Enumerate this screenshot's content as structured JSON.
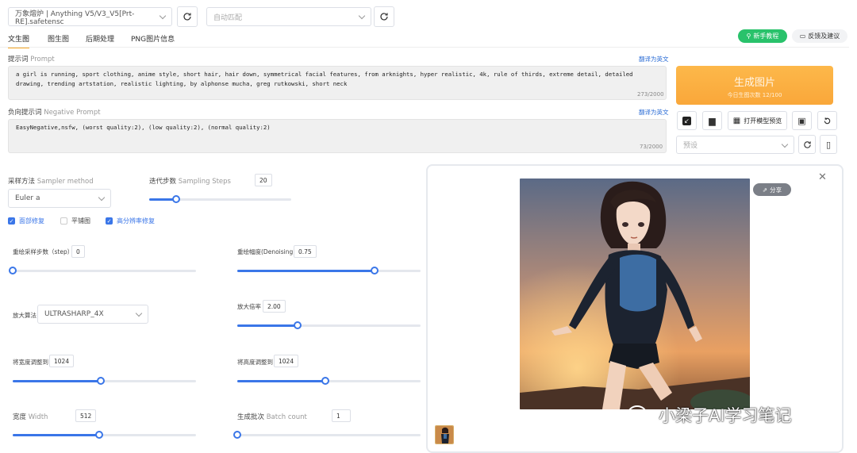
{
  "header": {
    "model_select": "万象熔炉 | Anything V5/V3_V5[Prt-RE].safetensc",
    "vae_placeholder": "自动匹配"
  },
  "tabs": [
    "文生图",
    "图生图",
    "后期处理",
    "PNG图片信息"
  ],
  "top_buttons": {
    "tutorial": "新手教程",
    "feedback": "反馈及建议"
  },
  "prompt": {
    "label": "提示词",
    "label_en": "Prompt",
    "translate": "翻译为英文",
    "text": "a girl is running, sport clothing, anime style, short hair, hair down, symmetrical facial features, from arknights, hyper realistic, 4k, rule of thirds, extreme detail, detailed drawing, trending artstation, realistic lighting, by alphonse mucha, greg rutkowski, short neck",
    "counter": "273/2000"
  },
  "negative": {
    "label": "负向提示词",
    "label_en": "Negative Prompt",
    "translate": "翻译为英文",
    "text": "EasyNegative,nsfw, (worst quality:2), (low quality:2), (normal quality:2)",
    "counter": "73/2000"
  },
  "generate": {
    "label": "生成图片",
    "sub": "今日生图次数 12/100"
  },
  "actions": {
    "open_preview": "打开模型预览",
    "preset_placeholder": "预设"
  },
  "sampler": {
    "label": "采样方法",
    "label_en": "Sampler method",
    "value": "Euler a"
  },
  "steps": {
    "label": "迭代步数",
    "label_en": "Sampling Steps",
    "value": "20",
    "fraction": 0.19
  },
  "checkboxes": [
    {
      "label": "面部修复",
      "checked": true
    },
    {
      "label": "平铺图",
      "checked": false
    },
    {
      "label": "高分辨率修复",
      "checked": true
    }
  ],
  "hires": {
    "steps": {
      "label": "重绘采样步数（step）",
      "value": "0",
      "fraction": 0.0
    },
    "denoise": {
      "label": "重绘幅度(Denoising)",
      "value": "0.75",
      "fraction": 0.75
    },
    "upscaler": {
      "label": "放大算法",
      "value": "ULTRASHARP_4X"
    },
    "scale": {
      "label": "放大倍率",
      "value": "2.00",
      "fraction": 0.33
    },
    "width_to": {
      "label": "将宽度调整到",
      "value": "1024",
      "fraction": 0.48
    },
    "height_to": {
      "label": "将高度调整到",
      "value": "1024",
      "fraction": 0.48
    }
  },
  "size": {
    "width": {
      "label": "宽度",
      "label_en": "Width",
      "value": "512",
      "fraction": 0.47
    },
    "batch": {
      "label": "生成批次",
      "label_en": "Batch count",
      "value": "1",
      "fraction": 0.0
    }
  },
  "preview": {
    "share": "分享",
    "watermark": "小梁子AI学习笔记"
  },
  "colors": {
    "accent": "#3a76e8",
    "generate": "#fcae3c",
    "green": "#29c26b"
  }
}
